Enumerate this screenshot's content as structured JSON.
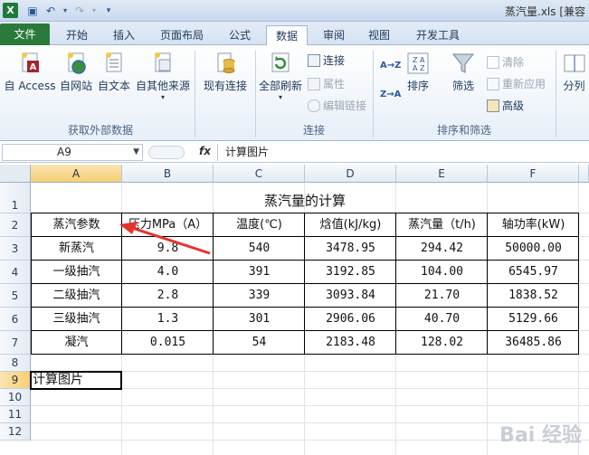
{
  "window": {
    "title": "蒸汽量.xls  [兼容"
  },
  "qat": {
    "save_icon": "save-icon",
    "undo_icon": "undo-icon",
    "redo_icon": "redo-icon",
    "customize_icon": "dropdown-icon"
  },
  "tabs": [
    {
      "label": "文件"
    },
    {
      "label": "开始"
    },
    {
      "label": "插入"
    },
    {
      "label": "页面布局"
    },
    {
      "label": "公式"
    },
    {
      "label": "数据"
    },
    {
      "label": "审阅"
    },
    {
      "label": "视图"
    },
    {
      "label": "开发工具"
    }
  ],
  "ribbon": {
    "access": "自 Access",
    "web": "自网站",
    "text": "自文本",
    "other": "自其他来源",
    "existing": "现有连接",
    "refresh": "全部刷新",
    "connections": "连接",
    "properties": "属性",
    "edit_links": "编辑链接",
    "sort": "排序",
    "filter": "筛选",
    "clear": "清除",
    "reapply": "重新应用",
    "advanced": "高级",
    "split": "分列",
    "sort_az": "A→Z",
    "sort_za": "Z→A",
    "groups": {
      "external": "获取外部数据",
      "conn": "连接",
      "sortfilter": "排序和筛选"
    }
  },
  "formula_bar": {
    "name": "A9",
    "fx": "fx",
    "content": "计算图片"
  },
  "grid": {
    "columns": [
      "A",
      "B",
      "C",
      "D",
      "E",
      "F"
    ],
    "rows": [
      "1",
      "2",
      "3",
      "4",
      "5",
      "6",
      "7",
      "8",
      "9",
      "10",
      "11",
      "12"
    ],
    "title": "蒸汽量的计算",
    "headers": [
      "蒸汽参数",
      "压力MPa（A）",
      "温度(℃)",
      "焓值(kJ/kg)",
      "蒸汽量（t/h)",
      "轴功率(kW)"
    ],
    "data": [
      [
        "新蒸汽",
        "9.8",
        "540",
        "3478.95",
        "294.42",
        "50000.00"
      ],
      [
        "一级抽汽",
        "4.0",
        "391",
        "3192.85",
        "104.00",
        "6545.97"
      ],
      [
        "二级抽汽",
        "2.8",
        "339",
        "3093.84",
        "21.70",
        "1838.52"
      ],
      [
        "三级抽汽",
        "1.3",
        "301",
        "2906.06",
        "40.70",
        "5129.66"
      ],
      [
        "凝汽",
        "0.015",
        "54",
        "2183.48",
        "128.02",
        "36485.86"
      ]
    ],
    "a9": "计算图片"
  },
  "watermark": "Bai 经验"
}
